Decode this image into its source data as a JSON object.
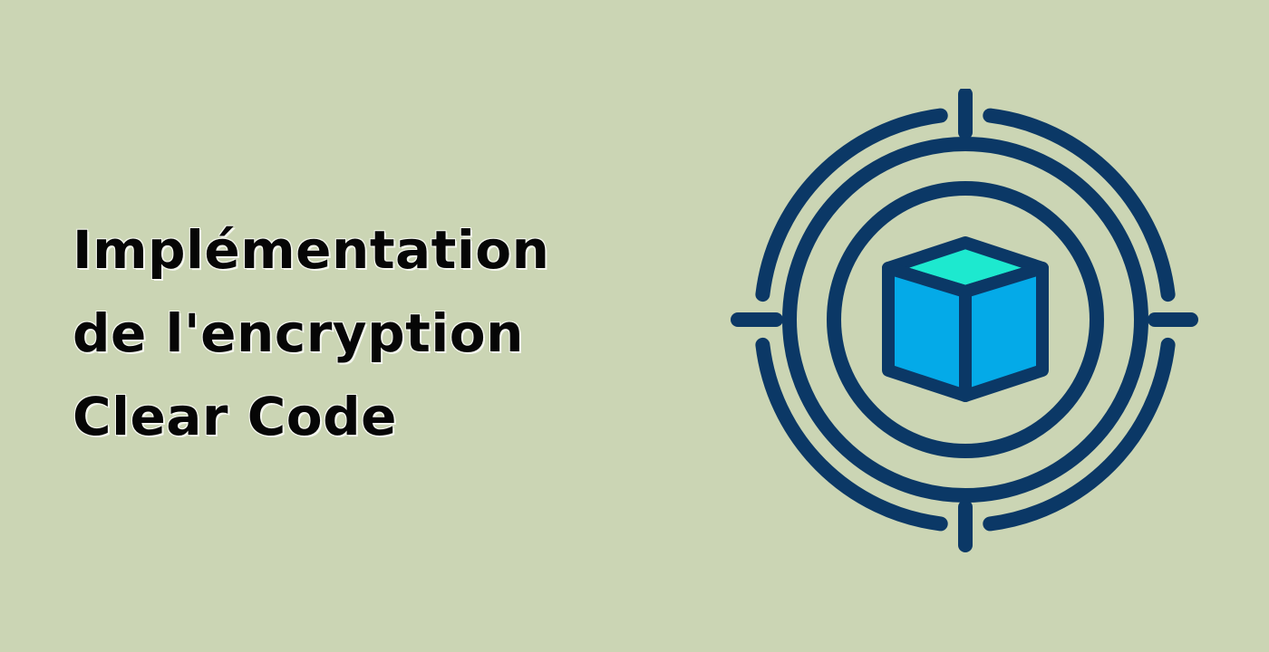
{
  "title": {
    "lines": [
      "Implémentation",
      "de l'encryption",
      "Clear Code"
    ]
  },
  "illustration": {
    "icon": "target-cube-icon",
    "colors": {
      "background": "#cbd5b4",
      "outline": "#0b3866",
      "cube_top": "#1de9cf",
      "cube_front": "#04aae8"
    }
  }
}
